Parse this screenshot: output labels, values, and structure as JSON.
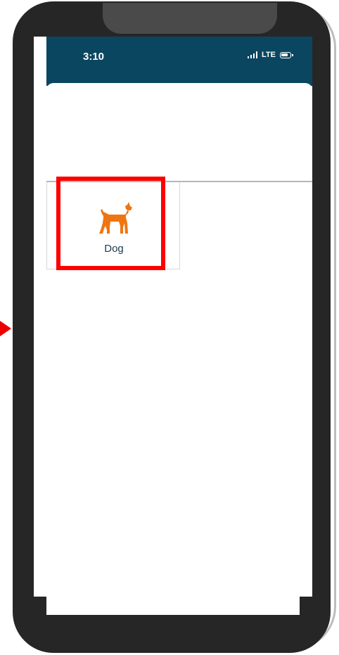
{
  "status_bar": {
    "time": "3:10",
    "network": "LTE",
    "icons": [
      "signal-icon",
      "battery-icon"
    ]
  },
  "grid": {
    "items": [
      {
        "label": "Dog",
        "icon": "dog-icon",
        "icon_color": "#ee7511"
      }
    ]
  },
  "annotation": {
    "highlight_color": "#ff0000",
    "arrow_color": "#ee0000"
  },
  "colors": {
    "header_bg": "#0a4660",
    "phone_frame": "#262626",
    "label_text": "#1d3a4d"
  }
}
